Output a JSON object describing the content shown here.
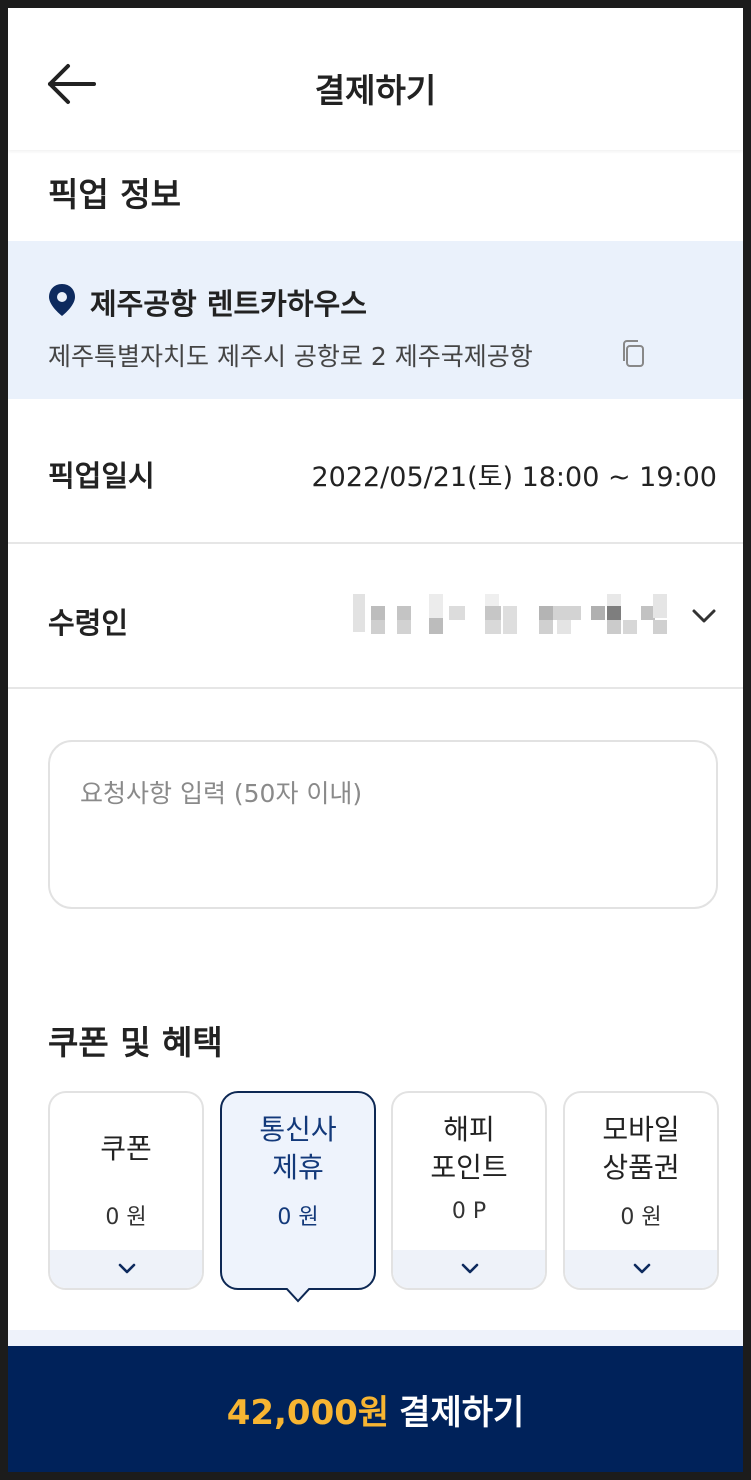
{
  "header": {
    "title": "결제하기",
    "back_icon": "arrow-left-icon"
  },
  "pickup": {
    "section_title": "픽업 정보",
    "location": {
      "name": "제주공항 렌트카하우스",
      "address": "제주특별자치도 제주시 공항로 2 제주국제공항",
      "pin_icon": "location-pin-icon",
      "copy_icon": "copy-icon",
      "pin_color": "#0d2a5e"
    },
    "datetime_label": "픽업일시",
    "datetime_value": "2022/05/21(토) 18:00 ~ 19:00",
    "recipient_label": "수령인"
  },
  "request": {
    "placeholder": "요청사항 입력 (50자 이내)"
  },
  "benefits": {
    "section_title": "쿠폰 및 혜택",
    "cards": [
      {
        "label": "쿠폰",
        "amount": "0 원",
        "active": false
      },
      {
        "label": "통신사\n제휴",
        "amount": "0 원",
        "active": true
      },
      {
        "label": "해피\n포인트",
        "amount": "0 P",
        "active": false
      },
      {
        "label": "모바일\n상품권",
        "amount": "0 원",
        "active": false
      }
    ]
  },
  "pay": {
    "amount": "42,000원",
    "label": "결제하기"
  },
  "colors": {
    "brand_navy": "#00225a",
    "accent_yellow": "#f7b532",
    "location_bg": "#eaf1fb"
  }
}
